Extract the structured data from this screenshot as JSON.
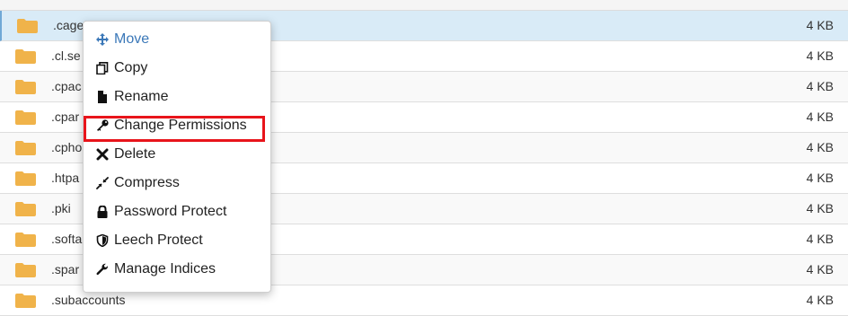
{
  "files": [
    {
      "name": ".cagef",
      "size": "4 KB",
      "selected": true
    },
    {
      "name": ".cl.se",
      "size": "4 KB",
      "selected": false
    },
    {
      "name": ".cpac",
      "size": "4 KB",
      "selected": false
    },
    {
      "name": ".cpar",
      "size": "4 KB",
      "selected": false
    },
    {
      "name": ".cpho",
      "size": "4 KB",
      "selected": false
    },
    {
      "name": ".htpa",
      "size": "4 KB",
      "selected": false
    },
    {
      "name": ".pki",
      "size": "4 KB",
      "selected": false
    },
    {
      "name": ".softa",
      "size": "4 KB",
      "selected": false
    },
    {
      "name": ".spar",
      "size": "4 KB",
      "selected": false
    },
    {
      "name": ".subaccounts",
      "size": "4 KB",
      "selected": false
    }
  ],
  "context_menu": {
    "items": [
      {
        "label": "Move",
        "icon": "move-icon"
      },
      {
        "label": "Copy",
        "icon": "copy-icon"
      },
      {
        "label": "Rename",
        "icon": "file-icon"
      },
      {
        "label": "Change Permissions",
        "icon": "key-icon"
      },
      {
        "label": "Delete",
        "icon": "close-icon"
      },
      {
        "label": "Compress",
        "icon": "compress-icon"
      },
      {
        "label": "Password Protect",
        "icon": "lock-icon"
      },
      {
        "label": "Leech Protect",
        "icon": "shield-icon"
      },
      {
        "label": "Manage Indices",
        "icon": "wrench-icon"
      }
    ],
    "highlighted": "Change Permissions"
  },
  "colors": {
    "folder": "#f0b34a",
    "selected_row": "#d9ebf7",
    "link_blue": "#3b78b8",
    "highlight_red": "#e8141b"
  }
}
